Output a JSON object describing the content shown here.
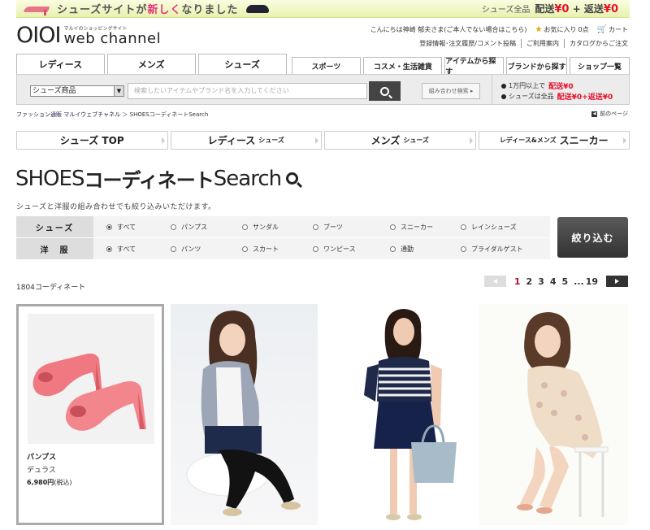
{
  "banner": {
    "text_prefix": "シューズサイトが",
    "text_highlight": "新しく",
    "text_suffix": "なりました",
    "right_label": "シューズ全品",
    "ship_label": "配送",
    "ship_value": "¥0",
    "plus": "+",
    "return_label": "返送",
    "return_value": "¥0"
  },
  "logo": {
    "mark": "OIOI",
    "tagline": "マルイのショッピングサイト",
    "name": "web channel"
  },
  "user": {
    "greeting": "こんにちは神崎 郁夫さま(ご本人でない場合はこちら)",
    "favorites_label": "お気に入り",
    "favorites_count": "0点",
    "cart_label": "カート"
  },
  "sublinks": [
    "登録情報･注文履歴/コメント投稿",
    "ご利用案内",
    "カタログからご注文"
  ],
  "tabs": {
    "main": [
      "レディース",
      "メンズ",
      "シューズ"
    ],
    "sub": [
      "スポーツ",
      "コスメ・生活雑貨",
      "アイテムから探す",
      "ブランドから探す",
      "ショップ一覧"
    ]
  },
  "search": {
    "category_value": "シューズ商品",
    "placeholder": "検索したいアイテムやブランド名を入力してください",
    "combo_label": "組み合わせ検索 ▸"
  },
  "shipping": {
    "line1_text": "1万円以上で",
    "line1_label": "配送",
    "line1_value": "¥0",
    "line2_text": "シューズは全品",
    "line2_label": "配送",
    "line2_value": "¥0+返送¥0"
  },
  "breadcrumb": {
    "home": "ファッション通販 マルイウェブチャネル",
    "sep": "＞",
    "current": "SHOESコーディネートSearch"
  },
  "back_label": "前のページ",
  "shoes_nav": [
    {
      "label": "シューズ TOP",
      "sub": ""
    },
    {
      "label": "レディース",
      "sub": "シューズ"
    },
    {
      "label": "メンズ",
      "sub": "シューズ"
    },
    {
      "label": "スニーカー",
      "sub": "レディース&メンズ"
    }
  ],
  "page": {
    "title_en": "SHOES",
    "title_jp": "コーディネート",
    "title_en2": "Search",
    "subtitle": "シューズと洋服の組み合わせでも絞り込みいただけます。"
  },
  "filter": {
    "shoes_label": "シューズ",
    "shoes_options": [
      "すべて",
      "パンプス",
      "サンダル",
      "ブーツ",
      "スニーカー",
      "レインシューズ"
    ],
    "clothes_label": "洋　服",
    "clothes_options": [
      "すべて",
      "パンツ",
      "スカート",
      "ワンピース",
      "通勤",
      "ブライダルゲスト"
    ],
    "submit_label": "絞り込む"
  },
  "results": {
    "count": "1804コーディネート",
    "pages": [
      "1",
      "2",
      "3",
      "4",
      "5"
    ],
    "ellipsis": "...",
    "last_page": "19"
  },
  "product": {
    "name": "パンプス",
    "brand": "デュラス",
    "price": "6,980円",
    "tax": "(税込)"
  }
}
